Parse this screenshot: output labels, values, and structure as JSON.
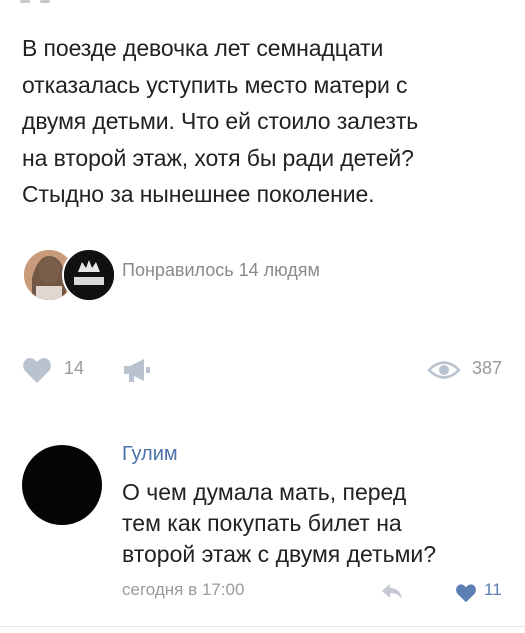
{
  "post": {
    "text": "В поезде девочка лет семнадцати\nотказалась уступить место матери с\nдвумя детьми. Что ей стоило залезть\nна второй этаж, хотя бы ради детей?\nСтыдно за нынешнее поколение."
  },
  "likes": {
    "summary": "Понравилось 14 людям"
  },
  "actions": {
    "like_count": "14",
    "views_count": "387",
    "icons": [
      "heart-icon",
      "megaphone-icon",
      "eye-icon"
    ]
  },
  "comment": {
    "author": "Гулим",
    "text": "О чем думала мать, перед\nтем как покупать билет на\nвторой этаж с двумя детьми?",
    "time": "сегодня в 17:00",
    "like_count": "11",
    "accent_color": "#5b7fb3"
  }
}
